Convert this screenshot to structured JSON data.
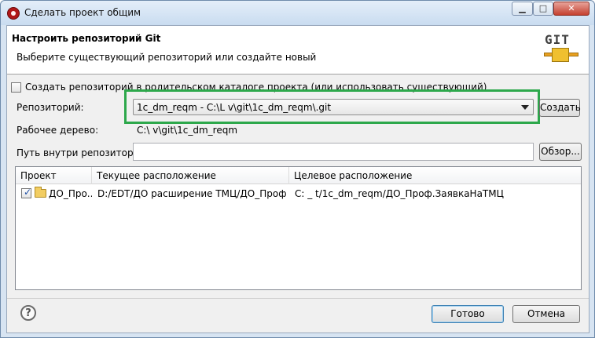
{
  "window": {
    "title": "Сделать проект общим",
    "minimize_glyph": "▁",
    "maximize_glyph": "□",
    "close_glyph": "✕"
  },
  "banner": {
    "title": "Настроить репозиторий Git",
    "subtitle": "Выберите существующий репозиторий или создайте новый",
    "logo_text": "GIT"
  },
  "options": {
    "create_in_parent_label": "Создать репозиторий в родительском каталоге проекта (или использовать существующий)",
    "create_in_parent_checked": false
  },
  "repository": {
    "label": "Репозиторий:",
    "selected_value": "1c_dm_reqm - C:\\L                        v\\git\\1c_dm_reqm\\.git",
    "create_button": "Создать",
    "highlight_color": "#2da84b"
  },
  "working_tree": {
    "label": "Рабочее дерево:",
    "value": "C:\\                           v\\git\\1c_dm_reqm"
  },
  "path_in_repo": {
    "label": "Путь внутри репозитория:",
    "value": "",
    "browse_button": "Обзор..."
  },
  "table": {
    "columns": [
      "Проект",
      "Текущее расположение",
      "Целевое расположение"
    ],
    "rows": [
      {
        "checked": true,
        "project": "ДО_Про...",
        "current": "D:/EDT/ДО расширение ТМЦ/ДО_Проф...",
        "target": "C:                                   _   t/1c_dm_reqm/ДО_Проф.ЗаявкаНаТМЦ"
      }
    ]
  },
  "footer": {
    "help_glyph": "?",
    "finish_button": "Готово",
    "cancel_button": "Отмена"
  }
}
